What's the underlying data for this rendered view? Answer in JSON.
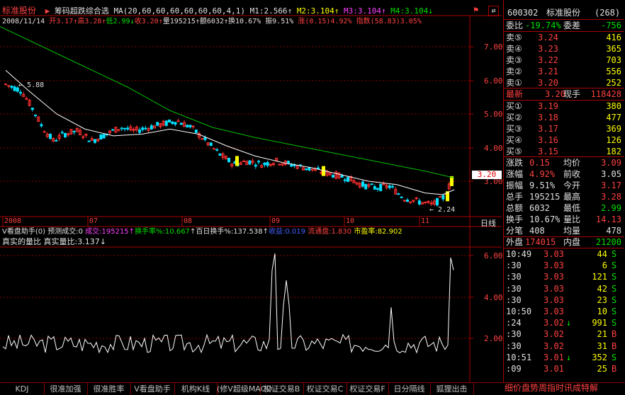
{
  "stock": {
    "name": "标准股份",
    "code": "600302",
    "count": "(268)"
  },
  "formula_title": "筹码超跌综合选",
  "ma_line": {
    "label": "MA(20,60,60,60,60,60,60,4,1)",
    "m1": "M1:2.566",
    "m2": "M2:3.104",
    "m3": "M3:3.104",
    "m4": "M4:3.104"
  },
  "info_line": {
    "date": "2008/11/14",
    "open": "开3.17",
    "high": "高3.28",
    "low": "低2.99",
    "close": "收3.20",
    "vol": "量195215",
    "amt": "额6032",
    "turn": "换10.67%",
    "amp": "振9.51%",
    "chg": "涨(0.15)4.92%",
    "index": "指数(58.83)3.05%"
  },
  "price_axis": [
    "7.00",
    "6.00",
    "5.00",
    "4.00",
    "3.00"
  ],
  "price_tag": "3.20",
  "price_labels": {
    "high": "5.88",
    "low": "2.24"
  },
  "time_axis": [
    "2008",
    "07",
    "08",
    "09",
    "10",
    "11"
  ],
  "period_label": "日线",
  "indicator_line": {
    "name": "V看盘助手(0)",
    "forecast": "预测成交:0",
    "deal": "成交:195215",
    "turnover": "换手率%:10.667",
    "hundred": "百日换手%:137.538",
    "profit": "收益:0.019",
    "float": "流通盘:1.830",
    "pe": "市盈率:82.902"
  },
  "sub_title": {
    "name": "真实的量比",
    "value": "真实量比:3.137"
  },
  "sub_axis": [
    "6.00",
    "4.00",
    "2.00"
  ],
  "right_panel": {
    "header": {
      "code": "600302",
      "name": "标准股份",
      "count": "(268)"
    },
    "ratio": {
      "l1": "委比",
      "v1": "-19.74%",
      "l2": "委差",
      "v2": "-756"
    },
    "sells": [
      {
        "label": "卖⑤",
        "price": "3.24",
        "vol": "416"
      },
      {
        "label": "卖④",
        "price": "3.23",
        "vol": "365"
      },
      {
        "label": "卖③",
        "price": "3.22",
        "vol": "703"
      },
      {
        "label": "卖②",
        "price": "3.21",
        "vol": "556"
      },
      {
        "label": "卖①",
        "price": "3.20",
        "vol": "252"
      }
    ],
    "last": {
      "l1": "最新",
      "v1": "3.20",
      "l2": "现手",
      "v2": "118428"
    },
    "buys": [
      {
        "label": "买①",
        "price": "3.19",
        "vol": "380"
      },
      {
        "label": "买②",
        "price": "3.18",
        "vol": "477"
      },
      {
        "label": "买③",
        "price": "3.17",
        "vol": "369"
      },
      {
        "label": "买④",
        "price": "3.16",
        "vol": "126"
      },
      {
        "label": "买⑤",
        "price": "3.15",
        "vol": "182"
      }
    ],
    "stats": [
      {
        "l1": "涨跌",
        "v1": "0.15",
        "l2": "均价",
        "v2": "3.09",
        "c1": "red",
        "c2": "red"
      },
      {
        "l1": "涨幅",
        "v1": "4.92%",
        "l2": "前收",
        "v2": "3.05",
        "c1": "red",
        "c2": "white"
      },
      {
        "l1": "振幅",
        "v1": "9.51%",
        "l2": "今开",
        "v2": "3.17",
        "c1": "white",
        "c2": "red"
      },
      {
        "l1": "总手",
        "v1": "195215",
        "l2": "最高",
        "v2": "3.28",
        "c1": "white",
        "c2": "red"
      },
      {
        "l1": "总额",
        "v1": "6032",
        "l2": "最低",
        "v2": "2.99",
        "c1": "white",
        "c2": "green"
      },
      {
        "l1": "换手",
        "v1": "10.67%",
        "l2": "量比",
        "v2": "14.13",
        "c1": "white",
        "c2": "red"
      },
      {
        "l1": "分笔",
        "v1": "408",
        "l2": "均量",
        "v2": "478",
        "c1": "white",
        "c2": "white"
      }
    ],
    "outer": {
      "l1": "外盘",
      "v1": "174015",
      "l2": "内盘",
      "v2": "21200"
    },
    "ticks": [
      {
        "time": "10:49",
        "price": "3.03",
        "arrow": "",
        "vol": "44",
        "side": "S"
      },
      {
        "time": ":30",
        "price": "3.03",
        "arrow": "",
        "vol": "6",
        "side": "S"
      },
      {
        "time": ":30",
        "price": "3.03",
        "arrow": "",
        "vol": "121",
        "side": "S"
      },
      {
        "time": ":30",
        "price": "3.03",
        "arrow": "",
        "vol": "42",
        "side": "S"
      },
      {
        "time": ":30",
        "price": "3.03",
        "arrow": "",
        "vol": "23",
        "side": "S"
      },
      {
        "time": "10:50",
        "price": "3.03",
        "arrow": "",
        "vol": "10",
        "side": "S"
      },
      {
        "time": ":24",
        "price": "3.02",
        "arrow": "↓",
        "vol": "991",
        "side": "S"
      },
      {
        "time": ":30",
        "price": "3.02",
        "arrow": "",
        "vol": "21",
        "side": "B"
      },
      {
        "time": ":30",
        "price": "3.02",
        "arrow": "",
        "vol": "31",
        "side": "B"
      },
      {
        "time": "10:51",
        "price": "3.01",
        "arrow": "↓",
        "vol": "352",
        "side": "S"
      },
      {
        "time": ":09",
        "price": "3.01",
        "arrow": "",
        "vol": "25",
        "side": "B"
      }
    ]
  },
  "tabs": [
    "KDJ",
    "很准加强",
    "很准胜率",
    "V看盘助手",
    "机构K线",
    "(修V超级MACD",
    "权证交易B",
    "权证交易C",
    "权证交易F",
    "日分隔线",
    "狐狸出击"
  ],
  "footer_link": "细价盘势周指时讯成特解"
}
